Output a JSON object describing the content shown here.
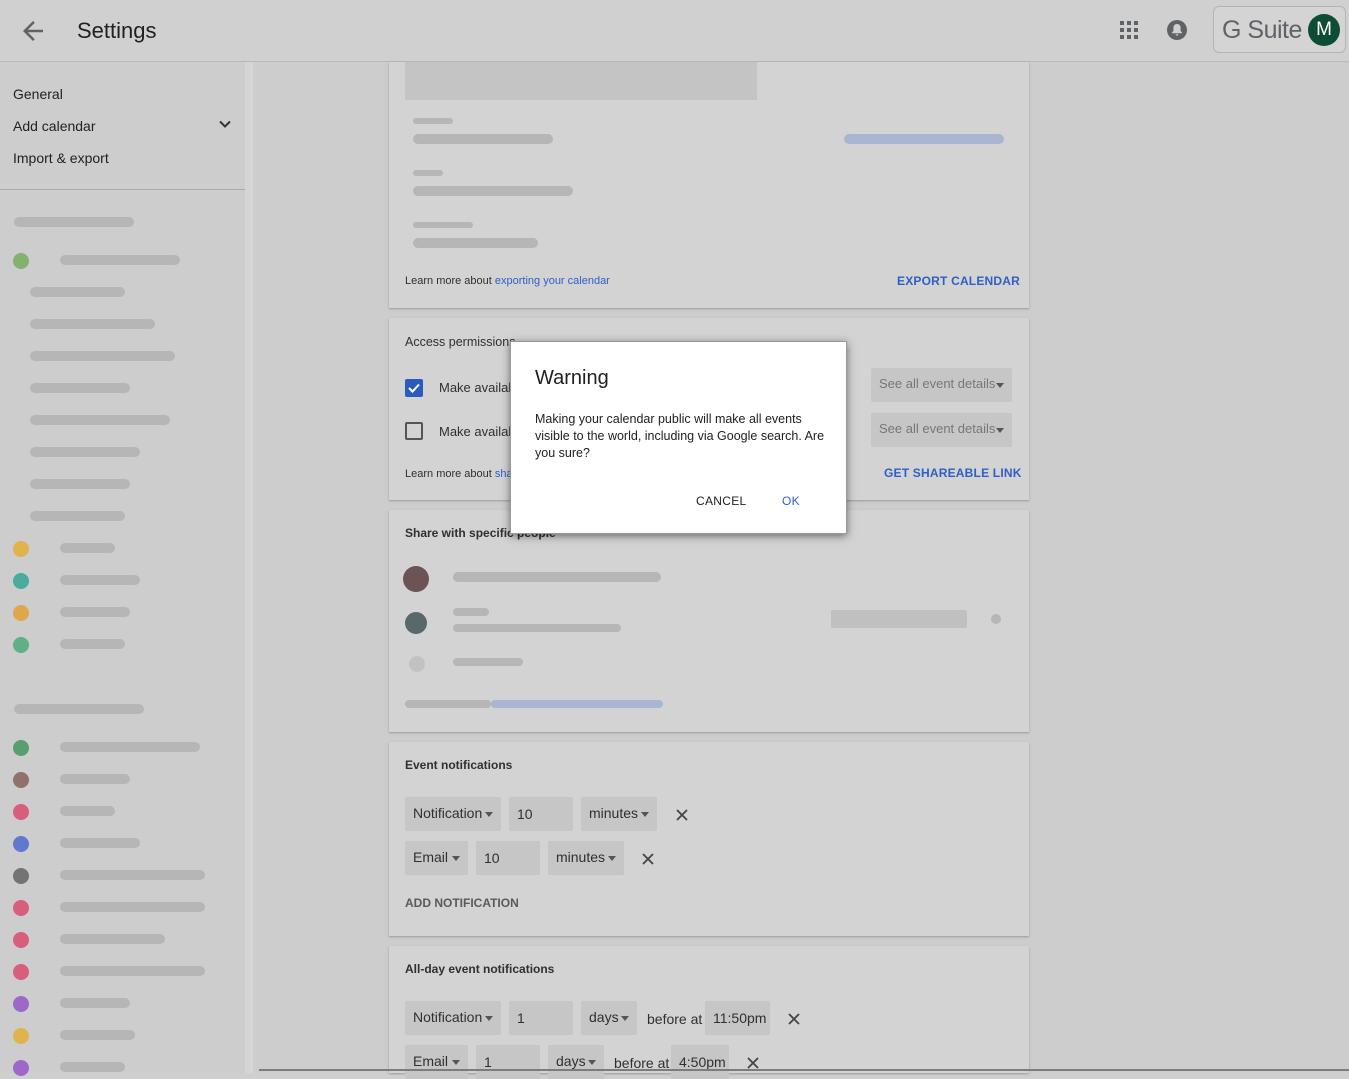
{
  "header": {
    "title": "Settings",
    "brand": "G Suite",
    "avatar_letter": "M"
  },
  "sidebar": {
    "items": [
      {
        "label": "General"
      },
      {
        "label": "Add calendar"
      },
      {
        "label": "Import & export"
      }
    ]
  },
  "export_card": {
    "learn_prefix": "Learn more about ",
    "learn_link": "exporting your calendar",
    "export_button": "EXPORT CALENDAR"
  },
  "access_card": {
    "title": "Access permissions",
    "row1_label": "Make availab",
    "row1_checked": true,
    "row1_select": "See all event details",
    "row2_label": "Make availab",
    "row2_checked": false,
    "row2_select": "See all event details",
    "learn_prefix": "Learn more about ",
    "learn_link": "sha",
    "shareable_button": "GET SHAREABLE LINK"
  },
  "share_card": {
    "title": "Share with specific people"
  },
  "event_notifications": {
    "title": "Event notifications",
    "rows": [
      {
        "type": "Notification",
        "value": "10",
        "unit": "minutes"
      },
      {
        "type": "Email",
        "value": "10",
        "unit": "minutes"
      }
    ],
    "add_button": "ADD NOTIFICATION"
  },
  "allday_notifications": {
    "title": "All-day event notifications",
    "rows": [
      {
        "type": "Notification",
        "value": "1",
        "unit": "days",
        "before": "before at",
        "time": "11:50pm"
      },
      {
        "type": "Email",
        "value": "1",
        "unit": "days",
        "before": "before at",
        "time": "4:50pm"
      }
    ]
  },
  "dialog": {
    "title": "Warning",
    "body": "Making your calendar public will make all events visible to the world, including via Google search. Are you sure?",
    "cancel": "CANCEL",
    "ok": "OK"
  },
  "colors": {
    "accent_blue": "#2f62d0",
    "avatar_green": "#0d4c35",
    "checkbox_blue": "#2a5bbd"
  },
  "icons": [
    "back-arrow-icon",
    "apps-grid-icon",
    "notifications-bell-icon",
    "chevron-down-icon",
    "close-icon",
    "dropdown-caret-icon"
  ]
}
